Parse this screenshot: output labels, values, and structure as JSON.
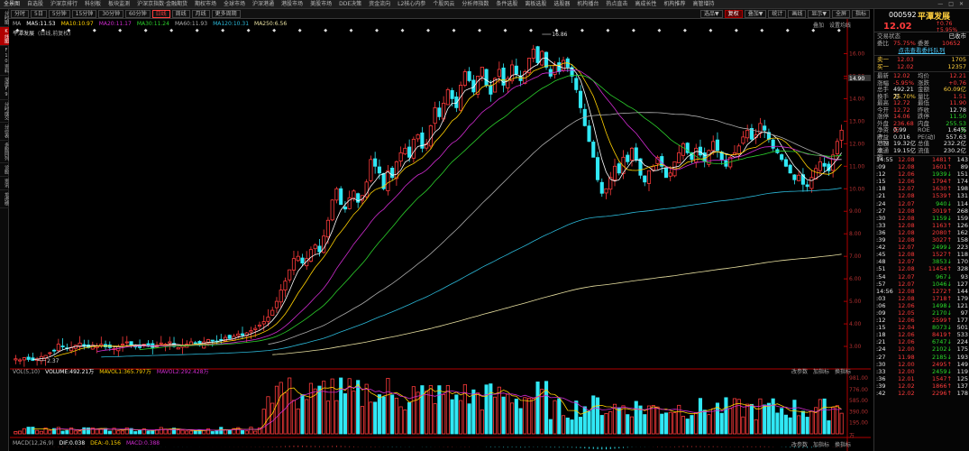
{
  "menu": [
    "全景图",
    "自选股",
    "沪深京排行",
    "科创板",
    "板块监测",
    "沪深京指数·金融期货",
    "期权市场",
    "全球市场",
    "沪深港通",
    "港股市场",
    "美股市场",
    "DDE决策",
    "资金流向",
    "L2核心内参",
    "个股风云",
    "分析师指数",
    "条件选股",
    "离板选股",
    "选股器",
    "机构播台",
    "热点直击",
    "高成长性",
    "机构推荐",
    "高管增持"
  ],
  "window_controls": [
    "—",
    "□",
    "✕"
  ],
  "toolbar": {
    "items": [
      "分时",
      "5日",
      "5分钟",
      "15分钟",
      "30分钟",
      "60分钟",
      "日线",
      "周线",
      "月线",
      "更多周期"
    ],
    "active": "日线",
    "right": [
      "选品▼",
      "复权",
      "叠加▼",
      "统计",
      "画线",
      "显示▼",
      "",
      "全屏",
      "指标"
    ],
    "right_highlight": "复权"
  },
  "left_tabs": [
    {
      "label": "分时图",
      "active": false
    },
    {
      "label": "K线图",
      "active": true
    },
    {
      "label": "F10资料",
      "active": false
    },
    {
      "label": "深度F9",
      "active": false
    },
    {
      "label": "分时成交",
      "active": false
    },
    {
      "label": "分价表",
      "active": false
    },
    {
      "label": "多股同列",
      "active": false
    },
    {
      "label": "诊股",
      "active": false
    },
    {
      "label": "资讯",
      "active": false
    },
    {
      "label": "龙虎榜",
      "active": false
    }
  ],
  "ma_legend": {
    "label": "MA",
    "items": [
      {
        "text": "MA5:11.53",
        "color": "#ffffff"
      },
      {
        "text": "MA10:10.97",
        "color": "#ffd000"
      },
      {
        "text": "MA20:11.17",
        "color": "#d02bd0"
      },
      {
        "text": "MA30:11.24",
        "color": "#2bd02b"
      },
      {
        "text": "MA60:11.93",
        "color": "#aaaaaa"
      },
      {
        "text": "MA120:10.31",
        "color": "#2bb8d8"
      },
      {
        "text": "MA250:6.56",
        "color": "#e8e0a0"
      }
    ]
  },
  "stock_tag": {
    "name": "平潭发展",
    "mode": "(日线,前复权)"
  },
  "chart_links_top": [
    "叠加",
    "设置均线"
  ],
  "chart_links_vol": [
    "改参数",
    "加指标",
    "换指标"
  ],
  "vol_legend": {
    "items": [
      {
        "text": "VOL(5,10)",
        "color": "#aaaaaa"
      },
      {
        "text": "VOLUME:492.21万",
        "color": "#ffffff"
      },
      {
        "text": "MAVOL1:365.797万",
        "color": "#ffd000"
      },
      {
        "text": "MAVOL2:292.428万",
        "color": "#d02bd0"
      }
    ]
  },
  "macd_legend": {
    "items": [
      {
        "text": "MACD(12,26,9)",
        "color": "#aaaaaa"
      },
      {
        "text": "DIF:0.038",
        "color": "#ffffff"
      },
      {
        "text": "DEA:-0.156",
        "color": "#ffd000"
      },
      {
        "text": "MACD:0.388",
        "color": "#d02bd0"
      }
    ]
  },
  "chart_data": {
    "type": "candlestick",
    "price_axis": {
      "min": 2.0,
      "max": 16.9,
      "ticks": [
        "16.00",
        "15.00",
        "14.90",
        "14.00",
        "13.00",
        "12.00",
        "11.00",
        "10.00",
        "9.00",
        "8.00",
        "7.00",
        "6.00",
        "5.00",
        "4.00",
        "3.00"
      ]
    },
    "vol_axis": {
      "max": 981,
      "ticks": [
        "981.00",
        "776.00",
        "585.00",
        "390.00",
        "195.00",
        "万"
      ]
    },
    "annotations": [
      {
        "text": "16.86",
        "value": 16.86,
        "index": 123
      },
      {
        "text": "2.37",
        "value": 2.37,
        "index": 5
      }
    ],
    "seed_closes": [
      2.45,
      2.4,
      2.5,
      2.42,
      2.38,
      2.45,
      2.55,
      2.6,
      2.72,
      2.8,
      3.1,
      3.0,
      2.9,
      2.95,
      3.05,
      3.15,
      3.0,
      2.95,
      3.05,
      3.0,
      3.1,
      2.98,
      2.95,
      2.9,
      3.0,
      3.1,
      3.2,
      3.05,
      3.0,
      2.95,
      3.1,
      3.0,
      2.95,
      3.05,
      3.15,
      3.1,
      3.2,
      3.0,
      2.95,
      3.05,
      3.1,
      3.2,
      3.15,
      3.05,
      3.2,
      3.3,
      3.25,
      3.2,
      3.3,
      3.4,
      3.35,
      3.45,
      3.55,
      3.5,
      3.6,
      3.7,
      3.8,
      3.95,
      4.1,
      4.3,
      4.6,
      5.0,
      5.5,
      5.9,
      6.4,
      6.9,
      7.0,
      6.7,
      6.9,
      7.3,
      7.5,
      7.2,
      7.9,
      8.6,
      9.5,
      10.0,
      9.3,
      9.1,
      9.6,
      9.9,
      9.4,
      9.7,
      10.3,
      11.3,
      11.0,
      10.7,
      10.0,
      10.8,
      10.5,
      11.2,
      11.6,
      11.8,
      11.4,
      12.2,
      12.4,
      11.8,
      12.0,
      12.8,
      13.6,
      13.2,
      13.8,
      14.4,
      14.0,
      13.6,
      14.6,
      15.2,
      14.8,
      14.3,
      15.0,
      15.4,
      14.6,
      14.2,
      14.9,
      15.3,
      14.6,
      14.9,
      15.5,
      15.1,
      14.8,
      15.2,
      15.8,
      16.2,
      15.6,
      16.1,
      15.4,
      15.0,
      15.5,
      15.2,
      15.7,
      15.4,
      15.0,
      14.4,
      13.6,
      12.8,
      12.1,
      11.4,
      10.4,
      9.8,
      10.0,
      10.5,
      11.0,
      10.7,
      11.4,
      11.2,
      11.8,
      11.3,
      10.6,
      10.3,
      10.8,
      11.0,
      11.4,
      11.0,
      10.5,
      10.7,
      11.2,
      11.6,
      12.0,
      11.6,
      11.3,
      11.8,
      11.5,
      11.2,
      11.7,
      12.1,
      11.7,
      11.3,
      11.0,
      11.4,
      11.6,
      11.9,
      12.3,
      12.6,
      12.2,
      12.4,
      12.9,
      12.6,
      12.2,
      11.8,
      11.6,
      11.3,
      11.0,
      10.7,
      10.4,
      10.6,
      10.2,
      10.1,
      10.5,
      10.9,
      11.2,
      11.0,
      10.8,
      11.5,
      12.1,
      12.6
    ]
  },
  "quote": {
    "code": "000592",
    "name": "平潭发展",
    "price": "12.02",
    "change": "0.76",
    "pct": "5.95%",
    "trade_status_k": "交易状态",
    "trade_status_v": "已收市",
    "wb_k": "委比",
    "wb_v": "75.75%",
    "wc_k": "委差",
    "wc_v": "10652",
    "link": "点击查看委托队列"
  },
  "orderbook": [
    {
      "k": "卖一",
      "p": "12.03",
      "v": "1705"
    },
    {
      "k": "买一",
      "p": "12.02",
      "v": "12357"
    }
  ],
  "stats": [
    {
      "a": "最新",
      "av": "12.02",
      "ac": "r",
      "b": "均价",
      "bv": "12.21",
      "bc": "r"
    },
    {
      "a": "涨幅",
      "av": "-5.95%",
      "ac": "r",
      "b": "涨跌",
      "bv": "+0.76",
      "bc": "r"
    },
    {
      "a": "总手",
      "av": "492.21万",
      "ac": "w",
      "b": "金额",
      "bv": "60.09亿",
      "bc": "y"
    },
    {
      "a": "换手",
      "av": "25.70%",
      "ac": "y",
      "b": "量比",
      "bv": "1.51",
      "bc": "r"
    },
    {
      "a": "最高",
      "av": "12.72",
      "ac": "r",
      "b": "最低",
      "bv": "11.90",
      "bc": "r"
    },
    {
      "a": "今开",
      "av": "12.72",
      "ac": "r",
      "b": "昨收",
      "bv": "12.78",
      "bc": "w"
    },
    {
      "a": "涨停",
      "av": "14.06",
      "ac": "r",
      "b": "跌停",
      "bv": "11.50",
      "bc": "g"
    },
    {
      "a": "外盘",
      "av": "236.68万",
      "ac": "r",
      "b": "内盘",
      "bv": "255.53万",
      "bc": "g"
    },
    {
      "a": "净资产",
      "av": "0.99",
      "ac": "w",
      "b": "ROE",
      "bv": "1.64%",
      "bc": "w"
    },
    {
      "a": "收益TTM",
      "av": "0.016",
      "ac": "w",
      "b": "PE(动)",
      "bv": "557.63",
      "bc": "w"
    },
    {
      "a": "总股本",
      "av": "19.32亿",
      "ac": "w",
      "b": "总值",
      "bv": "232.2亿",
      "bc": "w"
    },
    {
      "a": "流通股",
      "av": "19.15亿",
      "ac": "w",
      "b": "流值",
      "bv": "230.2亿",
      "bc": "w"
    }
  ],
  "ticks": [
    {
      "t": "14:55",
      "p": "12.08",
      "v": "1481",
      "n": "143",
      "vc": "r"
    },
    {
      "t": ":09",
      "p": "12.08",
      "v": "1601",
      "n": "89",
      "vc": "r"
    },
    {
      "t": ":12",
      "p": "12.06",
      "v": "1939",
      "n": "151",
      "vc": "g"
    },
    {
      "t": ":15",
      "p": "12.06",
      "v": "1794",
      "n": "174",
      "vc": "r"
    },
    {
      "t": ":18",
      "p": "12.07",
      "v": "1630",
      "n": "198",
      "vc": "r"
    },
    {
      "t": ":21",
      "p": "12.08",
      "v": "1539",
      "n": "131",
      "vc": "r"
    },
    {
      "t": ":24",
      "p": "12.07",
      "v": "940",
      "n": "114",
      "vc": "g"
    },
    {
      "t": ":27",
      "p": "12.08",
      "v": "3019",
      "n": "268",
      "vc": "r"
    },
    {
      "t": ":30",
      "p": "12.08",
      "v": "1159",
      "n": "159",
      "vc": "g"
    },
    {
      "t": ":33",
      "p": "12.08",
      "v": "1163",
      "n": "126",
      "vc": "r"
    },
    {
      "t": ":36",
      "p": "12.08",
      "v": "2080",
      "n": "162",
      "vc": "r"
    },
    {
      "t": ":39",
      "p": "12.08",
      "v": "3027",
      "n": "158",
      "vc": "r"
    },
    {
      "t": ":42",
      "p": "12.07",
      "v": "2499",
      "n": "223",
      "vc": "g"
    },
    {
      "t": ":45",
      "p": "12.08",
      "v": "1527",
      "n": "118",
      "vc": "r"
    },
    {
      "t": ":48",
      "p": "12.07",
      "v": "3853",
      "n": "170",
      "vc": "g"
    },
    {
      "t": ":51",
      "p": "12.08",
      "v": "11454",
      "n": "328",
      "vc": "r"
    },
    {
      "t": ":54",
      "p": "12.07",
      "v": "967",
      "n": "93",
      "vc": "g"
    },
    {
      "t": ":57",
      "p": "12.07",
      "v": "1046",
      "n": "127",
      "vc": "g"
    },
    {
      "t": "14:56",
      "p": "12.08",
      "v": "1272",
      "n": "144",
      "vc": "r"
    },
    {
      "t": ":03",
      "p": "12.08",
      "v": "1718",
      "n": "179",
      "vc": "r"
    },
    {
      "t": ":06",
      "p": "12.06",
      "v": "1498",
      "n": "121",
      "vc": "g"
    },
    {
      "t": ":09",
      "p": "12.05",
      "v": "2170",
      "n": "97",
      "vc": "g"
    },
    {
      "t": ":12",
      "p": "12.06",
      "v": "2599",
      "n": "177",
      "vc": "r"
    },
    {
      "t": ":15",
      "p": "12.04",
      "v": "8073",
      "n": "501",
      "vc": "g"
    },
    {
      "t": ":18",
      "p": "12.06",
      "v": "8419",
      "n": "533",
      "vc": "r"
    },
    {
      "t": ":21",
      "p": "12.06",
      "v": "6747",
      "n": "224",
      "vc": "g"
    },
    {
      "t": ":24",
      "p": "12.00",
      "v": "2102",
      "n": "175",
      "vc": "g"
    },
    {
      "t": ":27",
      "p": "11.98",
      "v": "2185",
      "n": "193",
      "vc": "g"
    },
    {
      "t": ":30",
      "p": "12.00",
      "v": "2495",
      "n": "149",
      "vc": "r"
    },
    {
      "t": ":33",
      "p": "12.00",
      "v": "2459",
      "n": "119",
      "vc": "g"
    },
    {
      "t": ":36",
      "p": "12.01",
      "v": "1547",
      "n": "125",
      "vc": "r"
    },
    {
      "t": ":39",
      "p": "12.02",
      "v": "1866",
      "n": "137",
      "vc": "r"
    },
    {
      "t": ":42",
      "p": "12.02",
      "v": "2296",
      "n": "178",
      "vc": "r"
    }
  ]
}
